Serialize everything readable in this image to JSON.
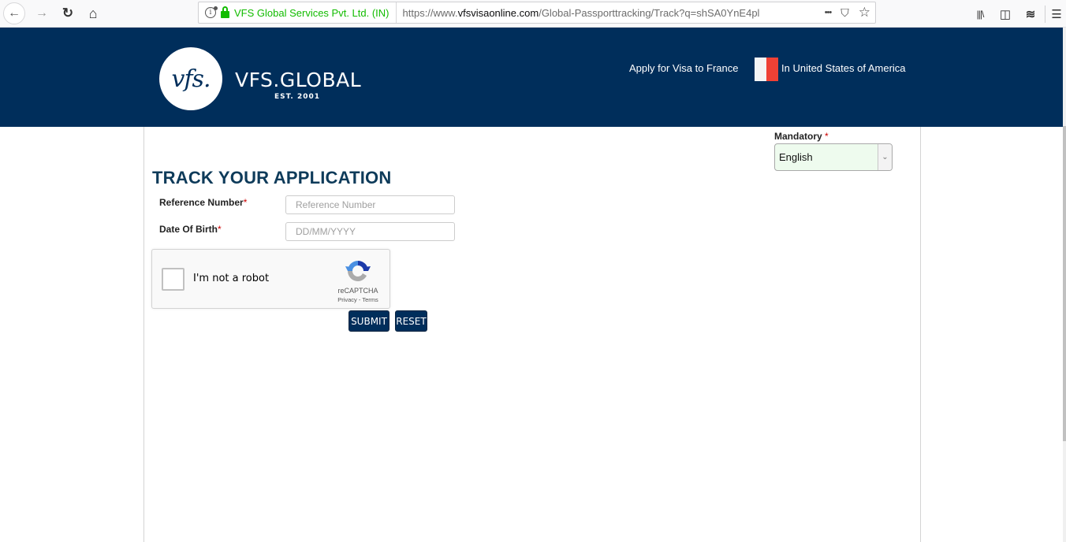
{
  "browser": {
    "identity_label": "VFS Global Services Pvt. Ltd. (IN)",
    "url_prefix": "https://www.",
    "url_domain": "vfsvisaonline.com",
    "url_path": "/Global-Passporttracking/Track?q=shSA0YnE4pl",
    "icons": {
      "back": "←",
      "forward": "→",
      "reload": "↻",
      "home": "⌂",
      "more": "•••",
      "pocket": "⛉",
      "bookmark": "☆",
      "library": "|||\\",
      "sidebar": "◫",
      "layers": "≋",
      "menu": "☰"
    }
  },
  "header": {
    "logo_mark": "vfs.",
    "logo_name": "VFS.GLOBAL",
    "logo_tagline": "EST. 2001",
    "apply_text": "Apply for Visa to France",
    "country_text": "In United States of America",
    "brand_color": "#002e5b"
  },
  "language": {
    "label": "Mandatory",
    "required_mark": "*",
    "selected": "English",
    "arrow": "⌄"
  },
  "form": {
    "title": "TRACK YOUR APPLICATION",
    "fields": [
      {
        "label": "Reference Number",
        "required_mark": "*",
        "placeholder": "Reference Number",
        "value": ""
      },
      {
        "label": "Date Of Birth",
        "required_mark": "*",
        "placeholder": "DD/MM/YYYY",
        "value": ""
      }
    ],
    "captcha": {
      "label": "I'm not a robot",
      "brand": "reCAPTCHA",
      "links": "Privacy - Terms",
      "checked": false
    },
    "submit_label": "SUBMIT",
    "reset_label": "RESET"
  }
}
